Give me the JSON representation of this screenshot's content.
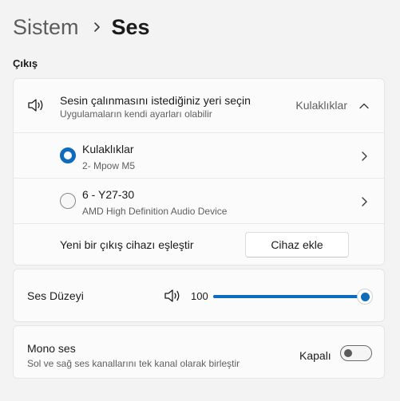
{
  "breadcrumb": {
    "parent": "Sistem",
    "current": "Ses"
  },
  "output_section": {
    "label": "Çıkış",
    "header": {
      "title": "Sesin çalınmasını istediğiniz yeri seçin",
      "subtitle": "Uygulamaların kendi ayarları olabilir",
      "selected_value": "Kulaklıklar",
      "icon": "speaker-icon",
      "expanded": true
    },
    "devices": [
      {
        "name": "Kulaklıklar",
        "detail": "2- Mpow M5",
        "selected": true
      },
      {
        "name": "6 - Y27-30",
        "detail": "AMD High Definition Audio Device",
        "selected": false
      }
    ],
    "pair": {
      "label": "Yeni bir çıkış cihazı eşleştir",
      "button": "Cihaz ekle"
    }
  },
  "volume": {
    "label": "Ses Düzeyi",
    "icon": "speaker-icon",
    "value": "100",
    "level": 1.0
  },
  "mono": {
    "title": "Mono ses",
    "subtitle": "Sol ve sağ ses kanallarını tek kanal olarak birleştir",
    "state_label": "Kapalı",
    "on": false
  },
  "colors": {
    "accent": "#0f6cbd",
    "background": "#f3f3f3",
    "card": "#fbfbfb"
  }
}
